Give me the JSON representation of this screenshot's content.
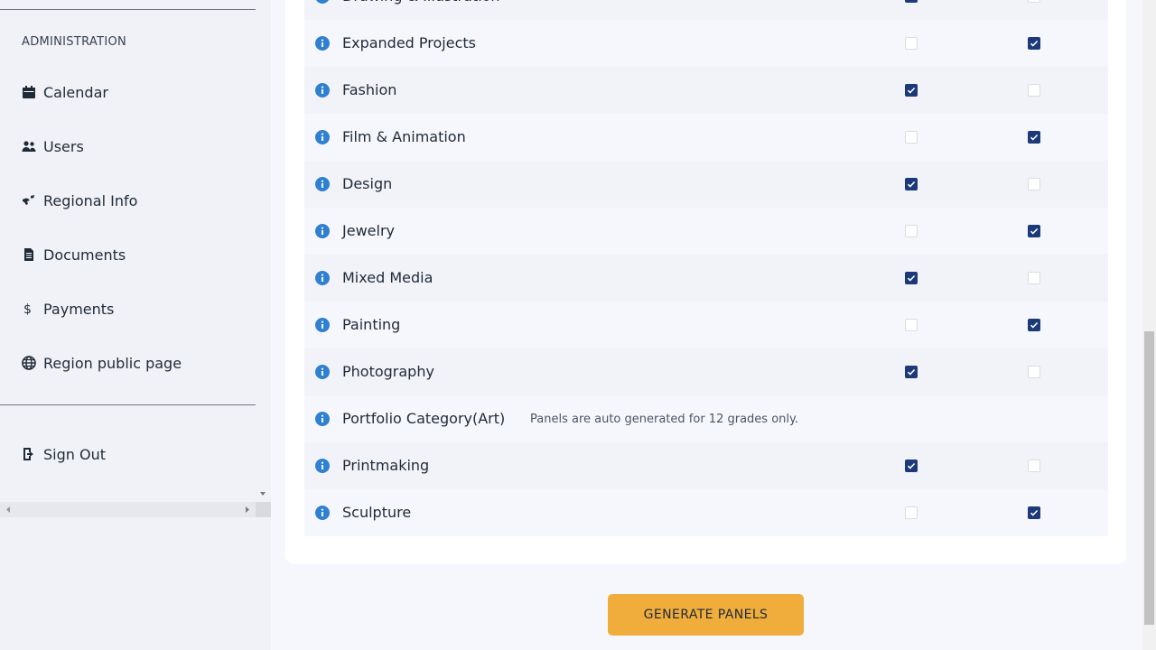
{
  "sidebar": {
    "section_title": "ADMINISTRATION",
    "items": [
      {
        "label": "Calendar",
        "icon": "calendar-icon"
      },
      {
        "label": "Users",
        "icon": "users-icon"
      },
      {
        "label": "Regional Info",
        "icon": "region-icon"
      },
      {
        "label": "Documents",
        "icon": "document-icon"
      },
      {
        "label": "Payments",
        "icon": "dollar-icon"
      },
      {
        "label": "Region public page",
        "icon": "globe-icon"
      }
    ],
    "sign_out": {
      "label": "Sign Out",
      "icon": "sign-out-icon"
    }
  },
  "categories": [
    {
      "label": "Drawing & Illustration",
      "col1": true,
      "col2": false
    },
    {
      "label": "Expanded Projects",
      "col1": false,
      "col2": true
    },
    {
      "label": "Fashion",
      "col1": true,
      "col2": false
    },
    {
      "label": "Film & Animation",
      "col1": false,
      "col2": true
    },
    {
      "label": "Design",
      "col1": true,
      "col2": false
    },
    {
      "label": "Jewelry",
      "col1": false,
      "col2": true
    },
    {
      "label": "Mixed Media",
      "col1": true,
      "col2": false
    },
    {
      "label": "Painting",
      "col1": false,
      "col2": true
    },
    {
      "label": "Photography",
      "col1": true,
      "col2": false
    },
    {
      "label": "Portfolio Category(Art)",
      "note": "Panels are auto generated for 12 grades only."
    },
    {
      "label": "Printmaking",
      "col1": true,
      "col2": false
    },
    {
      "label": "Sculpture",
      "col1": false,
      "col2": true
    }
  ],
  "generate_button": "GENERATE PANELS",
  "colors": {
    "accent_button": "#f0ad3c",
    "checkbox_checked": "#1c3a7a",
    "info_icon": "#2f80d0"
  }
}
